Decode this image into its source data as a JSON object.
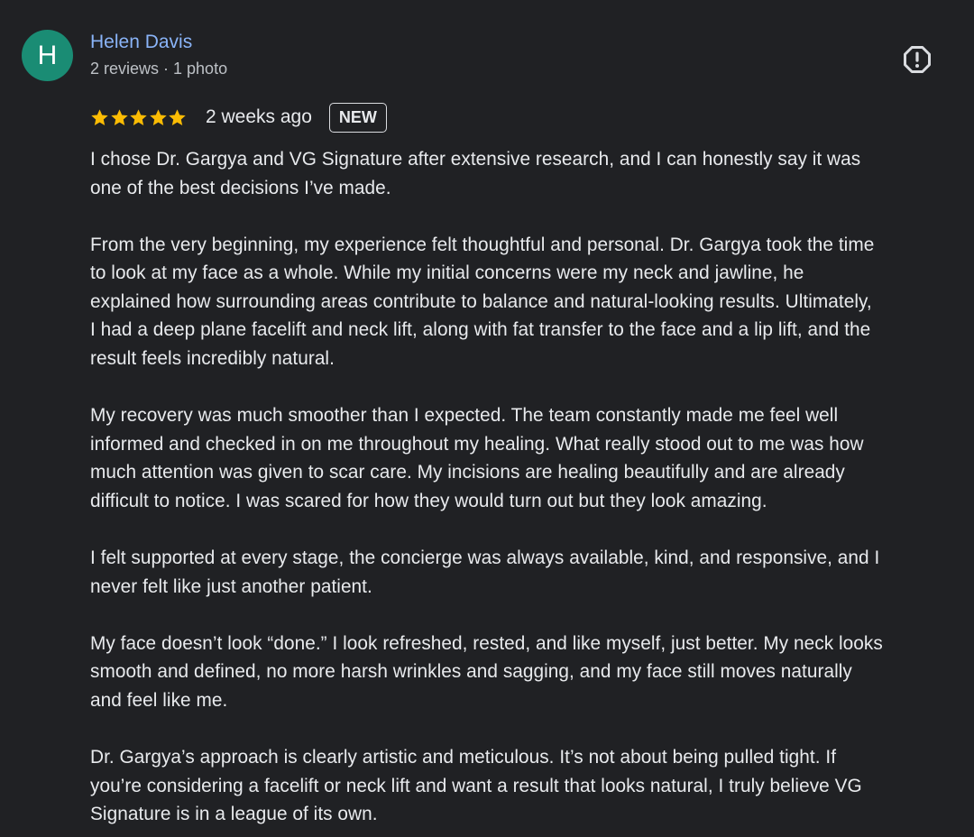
{
  "review": {
    "author": {
      "initial": "H",
      "name": "Helen Davis",
      "meta": "2 reviews · 1 photo",
      "avatar_color": "#1a8c74"
    },
    "report_icon": "alert-circle-icon",
    "rating": 5,
    "star_color": "#fbbc04",
    "time_ago": "2 weeks ago",
    "badge": "NEW",
    "paragraphs": [
      "I chose Dr. Gargya and VG Signature after extensive research, and I can honestly say it was\none of the best decisions I’ve made.",
      "From the very beginning, my experience felt thoughtful and personal. Dr. Gargya took the time\nto look at my face as a whole. While my initial concerns were my neck and jawline, he\nexplained how surrounding areas contribute to balance and natural-looking results. Ultimately,\nI had a deep plane facelift and neck lift, along with fat transfer to the face and a lip lift, and the\nresult feels incredibly natural.",
      "My recovery was much smoother than I expected. The team constantly made me feel well\ninformed and checked in on me throughout my healing. What really stood out to me was how\nmuch attention was given to scar care. My incisions are healing beautifully and are already\ndifficult to notice. I was scared for how they would turn out but they look amazing.",
      "I felt supported at every stage, the concierge was always available, kind, and responsive, and I\nnever felt like just another patient.",
      "My face doesn’t look “done.” I look refreshed, rested, and like myself, just better. My neck looks\nsmooth and defined, no more harsh wrinkles and sagging, and my face still moves naturally\nand feel like me.",
      "Dr. Gargya’s approach is clearly artistic and meticulous. It’s not about being pulled tight. If\nyou’re considering a facelift or neck lift and want a result that looks natural, I truly believe VG\nSignature is in a league of its own."
    ]
  }
}
